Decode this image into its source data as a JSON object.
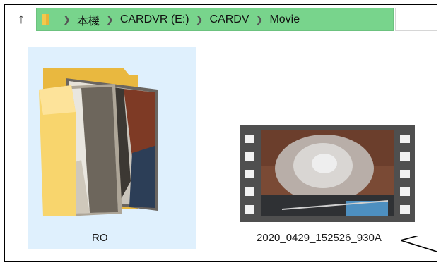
{
  "address_bar": {
    "up_icon": "up-arrow-icon",
    "folder_icon": "folder-icon",
    "crumbs": [
      "本機",
      "CARDVR (E:)",
      "CARDV",
      "Movie"
    ],
    "separator_icon": "chevron-right-icon",
    "highlight_color": "#78d48c"
  },
  "items": [
    {
      "name": "RO",
      "type": "folder",
      "selected": true
    },
    {
      "name": "2020_0429_152526_930A",
      "type": "video"
    }
  ],
  "colors": {
    "selection": "#dff0fd",
    "folder": "#f3c94c"
  }
}
